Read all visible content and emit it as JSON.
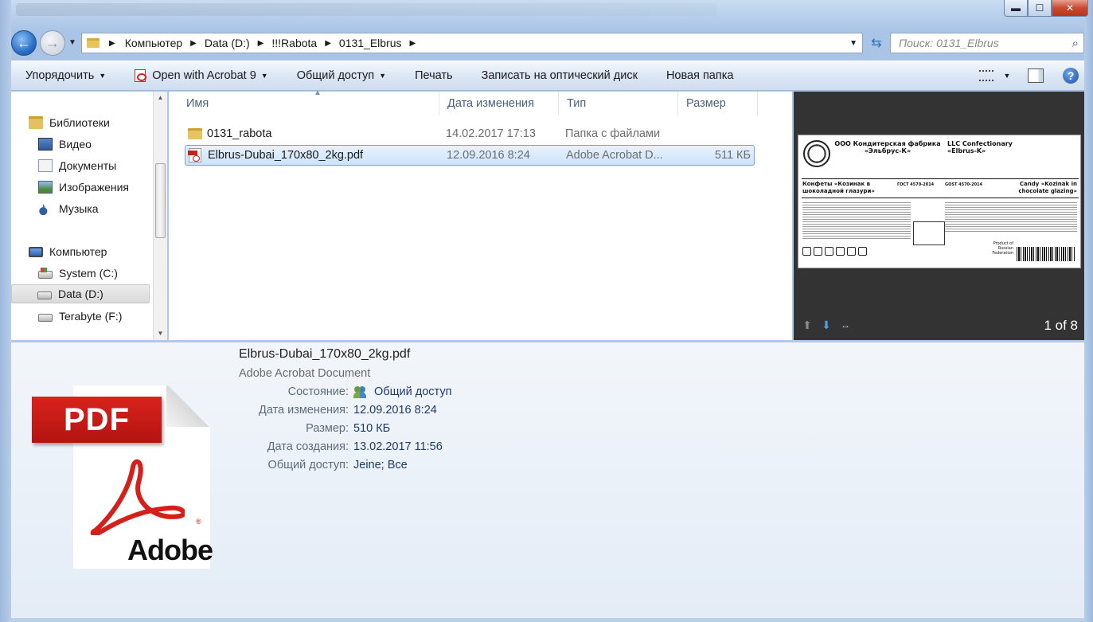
{
  "window": {
    "minimize": "▬",
    "maximize": "☐",
    "close": "✕"
  },
  "address": {
    "crumbs": [
      "Компьютер",
      "Data (D:)",
      "!!!Rabota",
      "0131_Elbrus"
    ],
    "search_placeholder": "Поиск: 0131_Elbrus"
  },
  "toolbar": {
    "organize": "Упорядочить",
    "open_with": "Open with Acrobat 9",
    "share": "Общий доступ",
    "print": "Печать",
    "burn": "Записать на оптический диск",
    "new_folder": "Новая папка",
    "help": "?"
  },
  "nav": {
    "libraries": "Библиотеки",
    "video": "Видео",
    "documents": "Документы",
    "images": "Изображения",
    "music": "Музыка",
    "computer": "Компьютер",
    "drive_c": "System (C:)",
    "drive_d": "Data (D:)",
    "drive_f": "Terabyte (F:)"
  },
  "columns": {
    "name": "Имя",
    "date": "Дата изменения",
    "type": "Тип",
    "size": "Размер"
  },
  "files": [
    {
      "name": "0131_rabota",
      "date": "14.02.2017 17:13",
      "type": "Папка с файлами",
      "size": ""
    },
    {
      "name": "Elbrus-Dubai_170x80_2kg.pdf",
      "date": "12.09.2016 8:24",
      "type": "Adobe Acrobat D...",
      "size": "511 КБ"
    }
  ],
  "preview": {
    "page_indicator": "1 of 8",
    "label": {
      "company_ru": "ООО Кондитерская фабрика «Эльбрус-К»",
      "company_en": "LLC Confectionary «Elbrus-K»",
      "product_ru": "Конфеты «Козинак в шоколадной глазури»",
      "gost_ru": "ГОСТ 4570-2014",
      "gost_en": "GOST 4570-2014",
      "product_en": "Candy «Kozinak in chocolate glazing»",
      "origin": "Product of Russian Federation"
    }
  },
  "details": {
    "filename": "Elbrus-Dubai_170x80_2kg.pdf",
    "filetype": "Adobe Acrobat Document",
    "icon_banner": "PDF",
    "icon_brand": "Adobe",
    "icon_reg": "®",
    "rows": [
      {
        "label": "Состояние:",
        "value": "Общий доступ"
      },
      {
        "label": "Дата изменения:",
        "value": "12.09.2016 8:24"
      },
      {
        "label": "Размер:",
        "value": "510 КБ"
      },
      {
        "label": "Дата создания:",
        "value": "13.02.2017 11:56"
      },
      {
        "label": "Общий доступ:",
        "value": "Jeine; Все"
      }
    ]
  }
}
